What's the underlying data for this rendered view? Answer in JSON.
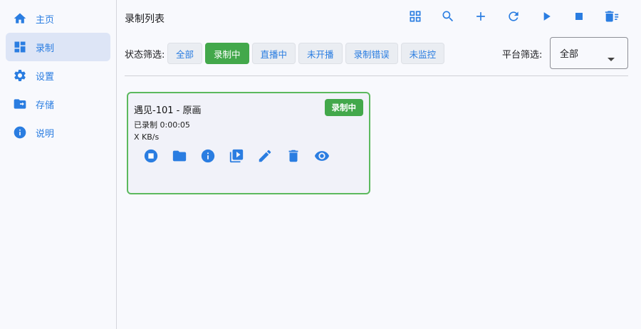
{
  "colors": {
    "accent": "#2a7de1",
    "recording": "#43a84b",
    "card_border": "#5cb95e"
  },
  "sidebar": {
    "items": [
      {
        "label": "主页",
        "icon": "home-icon",
        "active": false
      },
      {
        "label": "录制",
        "icon": "dashboard-icon",
        "active": true
      },
      {
        "label": "设置",
        "icon": "gear-icon",
        "active": false
      },
      {
        "label": "存储",
        "icon": "folder-icon",
        "active": false
      },
      {
        "label": "说明",
        "icon": "info-icon",
        "active": false
      }
    ]
  },
  "header": {
    "title": "录制列表",
    "toolbar": [
      "grid-view-icon",
      "search-icon",
      "add-icon",
      "refresh-icon",
      "play-icon",
      "stop-icon",
      "delete-list-icon"
    ]
  },
  "filters": {
    "status_label": "状态筛选:",
    "status_options": [
      "全部",
      "录制中",
      "直播中",
      "未开播",
      "录制错误",
      "未监控"
    ],
    "status_selected": "录制中",
    "platform_label": "平台筛选:",
    "platform_value": "全部"
  },
  "card": {
    "title": "遇见-101 - 原画",
    "badge": "录制中",
    "elapsed": "已录制 0:00:05",
    "speed": "X KB/s",
    "actions": [
      "stop-circle-icon",
      "folder-icon",
      "info-icon",
      "video-library-icon",
      "edit-icon",
      "delete-icon",
      "eye-icon"
    ]
  }
}
